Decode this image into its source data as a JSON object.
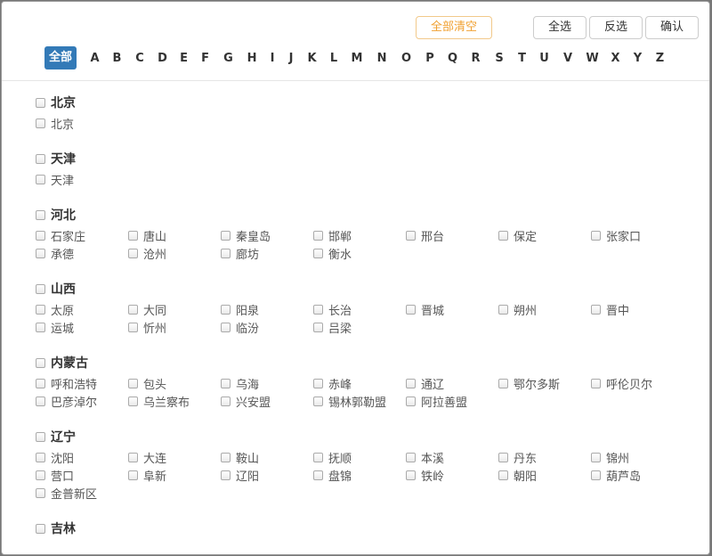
{
  "toolbar": {
    "clear_all": "全部清空",
    "select_all": "全选",
    "invert": "反选",
    "confirm": "确认"
  },
  "letters": [
    "全部",
    "A",
    "B",
    "C",
    "D",
    "E",
    "F",
    "G",
    "H",
    "I",
    "J",
    "K",
    "L",
    "M",
    "N",
    "O",
    "P",
    "Q",
    "R",
    "S",
    "T",
    "U",
    "V",
    "W",
    "X",
    "Y",
    "Z"
  ],
  "active_letter": "全部",
  "accent_color": "#337ab7",
  "provinces": [
    {
      "name": "北京",
      "cities": [
        "北京"
      ]
    },
    {
      "name": "天津",
      "cities": [
        "天津"
      ]
    },
    {
      "name": "河北",
      "cities": [
        "石家庄",
        "唐山",
        "秦皇岛",
        "邯郸",
        "邢台",
        "保定",
        "张家口",
        "承德",
        "沧州",
        "廊坊",
        "衡水"
      ]
    },
    {
      "name": "山西",
      "cities": [
        "太原",
        "大同",
        "阳泉",
        "长治",
        "晋城",
        "朔州",
        "晋中",
        "运城",
        "忻州",
        "临汾",
        "吕梁"
      ]
    },
    {
      "name": "内蒙古",
      "cities": [
        "呼和浩特",
        "包头",
        "乌海",
        "赤峰",
        "通辽",
        "鄂尔多斯",
        "呼伦贝尔",
        "巴彦淖尔",
        "乌兰察布",
        "兴安盟",
        "锡林郭勒盟",
        "阿拉善盟"
      ]
    },
    {
      "name": "辽宁",
      "cities": [
        "沈阳",
        "大连",
        "鞍山",
        "抚顺",
        "本溪",
        "丹东",
        "锦州",
        "营口",
        "阜新",
        "辽阳",
        "盘锦",
        "铁岭",
        "朝阳",
        "葫芦岛",
        "金普新区"
      ]
    },
    {
      "name": "吉林",
      "cities": []
    }
  ]
}
